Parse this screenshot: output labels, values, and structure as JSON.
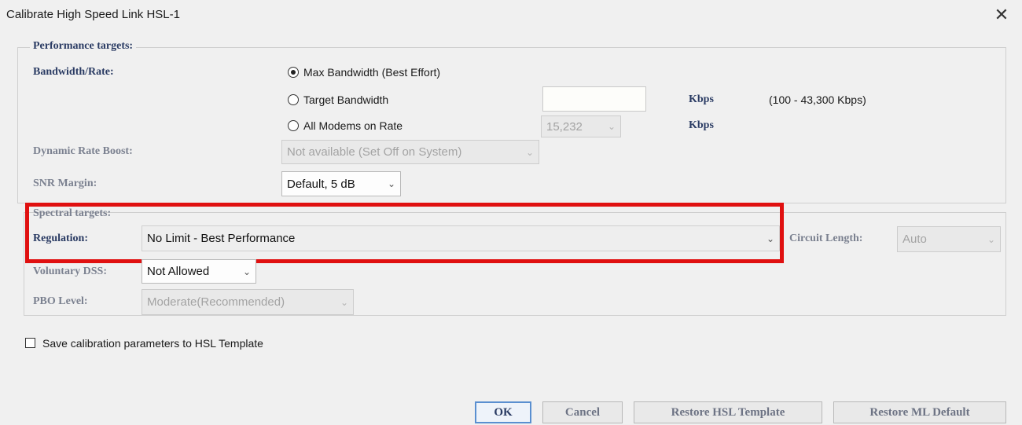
{
  "window": {
    "title": "Calibrate High Speed Link HSL-1",
    "close_glyph": "✕"
  },
  "performance": {
    "legend": "Performance targets:",
    "bandwidth_label": "Bandwidth/Rate:",
    "options": {
      "max_bandwidth": "Max Bandwidth (Best Effort)",
      "target_bandwidth": "Target Bandwidth",
      "all_modems": "All Modems on Rate"
    },
    "selected_option": "max_bandwidth",
    "target_bandwidth_value": "",
    "target_unit": "Kbps",
    "target_range": "(100 - 43,300 Kbps)",
    "rate_value": "15,232",
    "rate_unit": "Kbps",
    "dynamic_rate_boost_label": "Dynamic Rate Boost:",
    "dynamic_rate_boost_value": "Not available (Set Off on System)",
    "snr_margin_label": "SNR Margin:",
    "snr_margin_value": "Default, 5 dB"
  },
  "spectral": {
    "legend": "Spectral targets:",
    "regulation_label": "Regulation:",
    "regulation_value": "No Limit - Best Performance",
    "circuit_length_label": "Circuit Length:",
    "circuit_length_value": "Auto",
    "voluntary_dss_label": "Voluntary DSS:",
    "voluntary_dss_value": "Not Allowed",
    "pbo_level_label": "PBO Level:",
    "pbo_level_value": "Moderate(Recommended)"
  },
  "save_template": {
    "label": "Save calibration parameters to HSL Template",
    "checked": false
  },
  "buttons": {
    "ok": "OK",
    "cancel": "Cancel",
    "restore_hsl": "Restore HSL Template",
    "restore_ml": "Restore ML Default"
  },
  "icons": {
    "chevron": "chevron-down-icon",
    "close": "close-icon"
  },
  "colors": {
    "highlight": "#e01010",
    "label": "#2a3b63",
    "primary_button_border": "#5a8fd0"
  }
}
